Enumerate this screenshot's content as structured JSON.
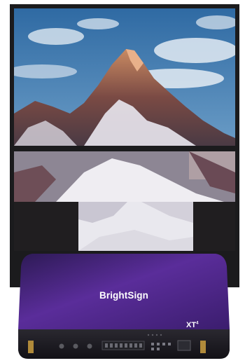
{
  "player": {
    "brand": "BrightSign",
    "model": "XT",
    "model_mark": "4"
  },
  "colors": {
    "sky": "#3f78ad",
    "cloud": "#e6eef5",
    "rock": "#8a4f45",
    "snow": "#f3f1f4",
    "player_purple": "#5b2f9a",
    "chassis": "#1d1c22"
  },
  "icons": [
    "power-led-icon",
    "sd-card-slot-icon",
    "usb-port-icon",
    "hdmi-port-icon",
    "ethernet-port-icon",
    "antenna-connector-icon"
  ]
}
